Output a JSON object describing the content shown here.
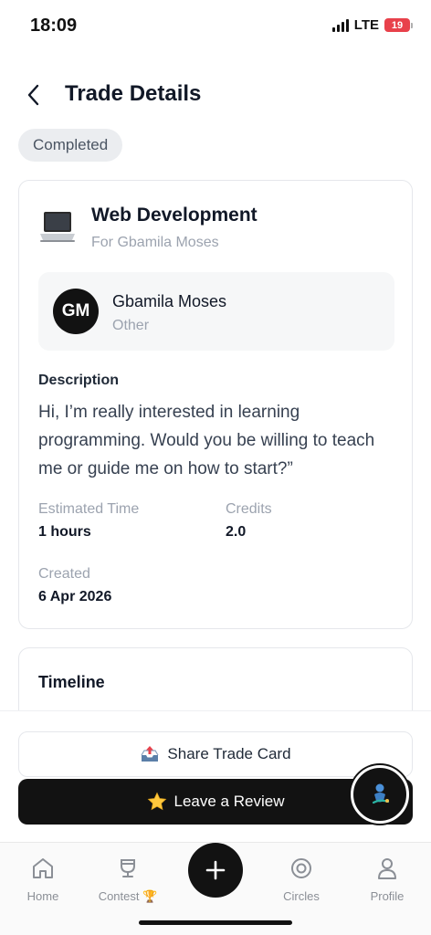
{
  "status_bar": {
    "time": "18:09",
    "network": "LTE",
    "battery": "19"
  },
  "header": {
    "title": "Trade Details"
  },
  "trade": {
    "status": "Completed",
    "skill_title": "Web Development",
    "skill_subtitle": "For Gbamila Moses",
    "person": {
      "initials": "GM",
      "name": "Gbamila Moses",
      "role": "Other"
    },
    "description_label": "Description",
    "description_text": "Hi, I’m really interested in learning programming. Would you be willing to teach me or guide me on how to start?”",
    "estimated_time_label": "Estimated Time",
    "estimated_time_value": "1 hours",
    "credits_label": "Credits",
    "credits_value": "2.0",
    "created_label": "Created",
    "created_value": "6 Apr 2026"
  },
  "timeline": {
    "title": "Timeline"
  },
  "actions": {
    "share_label": "Share Trade Card",
    "review_label": "Leave a Review"
  },
  "nav": {
    "items": [
      {
        "label": "Home",
        "icon": "home-icon"
      },
      {
        "label": "Contest 🏆",
        "icon": "trophy-icon"
      },
      {
        "label": "Circles",
        "icon": "circles-icon"
      },
      {
        "label": "Profile",
        "icon": "profile-icon"
      }
    ]
  },
  "colors": {
    "accent_dark": "#121212",
    "muted_text": "#9ca3af",
    "pill_bg": "#ebedf0",
    "battery_red": "#e8414b"
  }
}
